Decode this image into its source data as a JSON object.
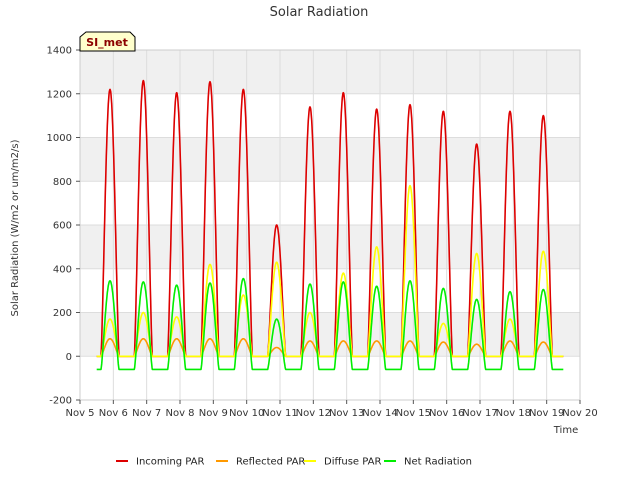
{
  "chart_data": {
    "type": "line",
    "title": "Solar Radiation",
    "xlabel": "Time",
    "ylabel": "Solar Radiation (W/m2 or um/m2/s)",
    "site_label": "SI_met",
    "ylim": [
      -200,
      1400
    ],
    "yticks": [
      -200,
      0,
      200,
      400,
      600,
      800,
      1000,
      1200,
      1400
    ],
    "xlim": [
      5,
      20
    ],
    "xticks": [
      {
        "value": 5,
        "label": "Nov 5"
      },
      {
        "value": 6,
        "label": "Nov 6"
      },
      {
        "value": 7,
        "label": "Nov 7"
      },
      {
        "value": 8,
        "label": "Nov 8"
      },
      {
        "value": 9,
        "label": "Nov 9"
      },
      {
        "value": 10,
        "label": "Nov 10"
      },
      {
        "value": 11,
        "label": "Nov 11"
      },
      {
        "value": 12,
        "label": "Nov 12"
      },
      {
        "value": 13,
        "label": "Nov 13"
      },
      {
        "value": 14,
        "label": "Nov 14"
      },
      {
        "value": 15,
        "label": "Nov 15"
      },
      {
        "value": 16,
        "label": "Nov 16"
      },
      {
        "value": 17,
        "label": "Nov 17"
      },
      {
        "value": 18,
        "label": "Nov 18"
      },
      {
        "value": 19,
        "label": "Nov 19"
      },
      {
        "value": 20,
        "label": "Nov 20"
      }
    ],
    "grid": true,
    "legend_position": "bottom",
    "series": [
      {
        "name": "Incoming PAR",
        "color": "#dd0000",
        "daily_peaks": [
          {
            "day": 5.9,
            "value": 1220
          },
          {
            "day": 6.9,
            "value": 1260
          },
          {
            "day": 7.9,
            "value": 1205
          },
          {
            "day": 8.9,
            "value": 1255
          },
          {
            "day": 9.9,
            "value": 1220
          },
          {
            "day": 10.9,
            "value": 600
          },
          {
            "day": 11.9,
            "value": 1140
          },
          {
            "day": 12.9,
            "value": 1205
          },
          {
            "day": 13.9,
            "value": 1130
          },
          {
            "day": 14.9,
            "value": 1150
          },
          {
            "day": 15.9,
            "value": 1120
          },
          {
            "day": 16.9,
            "value": 970
          },
          {
            "day": 17.9,
            "value": 1120
          },
          {
            "day": 18.9,
            "value": 1100
          }
        ]
      },
      {
        "name": "Reflected PAR",
        "color": "#ff9900",
        "daily_peaks": [
          {
            "day": 5.9,
            "value": 80
          },
          {
            "day": 6.9,
            "value": 80
          },
          {
            "day": 7.9,
            "value": 80
          },
          {
            "day": 8.9,
            "value": 80
          },
          {
            "day": 9.9,
            "value": 80
          },
          {
            "day": 10.9,
            "value": 40
          },
          {
            "day": 11.9,
            "value": 70
          },
          {
            "day": 12.9,
            "value": 70
          },
          {
            "day": 13.9,
            "value": 70
          },
          {
            "day": 14.9,
            "value": 70
          },
          {
            "day": 15.9,
            "value": 65
          },
          {
            "day": 16.9,
            "value": 55
          },
          {
            "day": 17.9,
            "value": 70
          },
          {
            "day": 18.9,
            "value": 65
          }
        ]
      },
      {
        "name": "Diffuse PAR",
        "color": "#ffff00",
        "daily_peaks": [
          {
            "day": 5.9,
            "value": 170
          },
          {
            "day": 6.9,
            "value": 200
          },
          {
            "day": 7.9,
            "value": 180
          },
          {
            "day": 8.9,
            "value": 420
          },
          {
            "day": 9.9,
            "value": 280
          },
          {
            "day": 10.9,
            "value": 430
          },
          {
            "day": 11.9,
            "value": 200
          },
          {
            "day": 12.9,
            "value": 380
          },
          {
            "day": 13.9,
            "value": 500
          },
          {
            "day": 14.9,
            "value": 780
          },
          {
            "day": 15.9,
            "value": 150
          },
          {
            "day": 16.9,
            "value": 470
          },
          {
            "day": 17.9,
            "value": 170
          },
          {
            "day": 18.9,
            "value": 480
          }
        ]
      },
      {
        "name": "Net Radiation",
        "color": "#00ee00",
        "night_value": -60,
        "daily_peaks": [
          {
            "day": 5.9,
            "value": 345
          },
          {
            "day": 6.9,
            "value": 340
          },
          {
            "day": 7.9,
            "value": 325
          },
          {
            "day": 8.9,
            "value": 335
          },
          {
            "day": 9.9,
            "value": 355
          },
          {
            "day": 10.9,
            "value": 170
          },
          {
            "day": 11.9,
            "value": 330
          },
          {
            "day": 12.9,
            "value": 340
          },
          {
            "day": 13.9,
            "value": 320
          },
          {
            "day": 14.9,
            "value": 345
          },
          {
            "day": 15.9,
            "value": 310
          },
          {
            "day": 16.9,
            "value": 260
          },
          {
            "day": 17.9,
            "value": 295
          },
          {
            "day": 18.9,
            "value": 305
          }
        ]
      }
    ]
  }
}
